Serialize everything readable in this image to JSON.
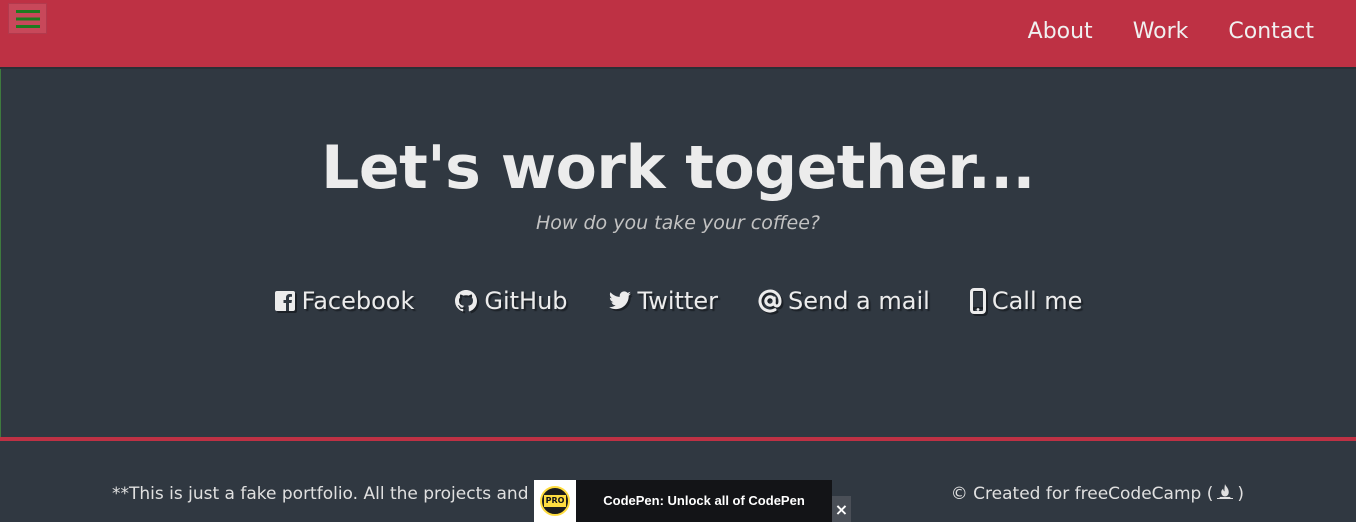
{
  "nav": {
    "links": [
      "About",
      "Work",
      "Contact"
    ]
  },
  "hero": {
    "title": "Let's work together...",
    "subtitle": "How do you take your coffee?"
  },
  "social": [
    {
      "label": "Facebook",
      "icon": "facebook-icon"
    },
    {
      "label": "GitHub",
      "icon": "github-icon"
    },
    {
      "label": "Twitter",
      "icon": "twitter-icon"
    },
    {
      "label": "Send a mail",
      "icon": "at-icon"
    },
    {
      "label": "Call me",
      "icon": "mobile-icon"
    }
  ],
  "footer": {
    "note": "**This is just a fake portfolio. All the projects and",
    "credit": "© Created for freeCodeCamp (",
    "credit_end": ")"
  },
  "promo": {
    "badge": "PRO",
    "text": "CodePen: Unlock all of CodePen",
    "close": "×"
  },
  "colors": {
    "brand": "#be3144",
    "background": "#303841",
    "text": "#ececec",
    "menu_icon": "#1f7a1f"
  }
}
